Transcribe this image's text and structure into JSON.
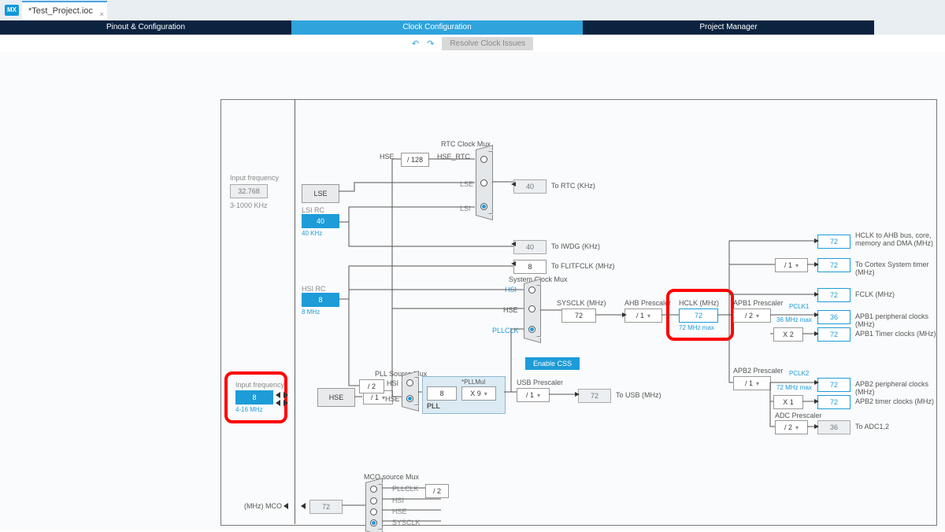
{
  "topbar": {
    "badge": "MX",
    "filename": "*Test_Project.ioc",
    "close": "×"
  },
  "tabs": {
    "t0": "Pinout & Configuration",
    "t1": "Clock Configuration",
    "t2": "Project Manager"
  },
  "toolbar": {
    "resolve": "Resolve Clock Issues"
  },
  "left": {
    "lse": {
      "label": "Input frequency",
      "value": "32.768",
      "range": "3-1000 KHz"
    },
    "hse": {
      "label": "Input frequency",
      "value": "8",
      "range": "4-16 MHz"
    },
    "lse_name": "LSE",
    "lse_rc": "LSI RC",
    "lse_rc_val": "40",
    "lse_rc_unit": "40 KHz",
    "hsi_rc": "HSI RC",
    "hsi_rc_val": "8",
    "hsi_rc_unit": "8 MHz",
    "hse_name": "HSE",
    "hse_div": "/ 1"
  },
  "rtc": {
    "title": "RTC Clock Mux",
    "hse": "HSE",
    "div": "/ 128",
    "hse_rtc": "HSE_RTC",
    "lse": "LSE",
    "lsi": "LSI",
    "out": "40",
    "out_lbl": "To RTC (KHz)"
  },
  "iwdg": {
    "value": "40",
    "label": "To IWDG (KHz)"
  },
  "flitf": {
    "value": "8",
    "label": "To FLITFCLK (MHz)"
  },
  "sysclk": {
    "title": "System Clock Mux",
    "hsi": "HSI",
    "hse": "HSE",
    "pllclk": "PLLCLK",
    "label": "SYSCLK (MHz)",
    "value": "72"
  },
  "css": "Enable CSS",
  "pll": {
    "src_title": "PLL Source Mux",
    "div2": "/ 2",
    "hsi": "HSI",
    "hse": "HSE",
    "title": "PLL",
    "pllmul_hdr": "*PLLMul",
    "input": "8",
    "mult": "X 9"
  },
  "usb": {
    "title": "USB Prescaler",
    "div": "/ 1",
    "value": "72",
    "label": "To USB (MHz)"
  },
  "ahb": {
    "label": "AHB Prescaler",
    "div": "/ 1"
  },
  "hclk": {
    "label": "HCLK (MHz)",
    "value": "72",
    "max": "72 MHz max"
  },
  "apb1": {
    "label": "APB1 Prescaler",
    "div": "/ 2",
    "max": "36 MHz max",
    "x": "X 2"
  },
  "apb2": {
    "label": "APB2 Prescaler",
    "div": "/ 1",
    "max": "72 MHz max",
    "x": "X 1"
  },
  "adc": {
    "label": "ADC Prescaler",
    "div": "/ 2",
    "value": "36",
    "out": "To ADC1,2"
  },
  "outs": {
    "ahb": {
      "v": "72",
      "l": "HCLK to AHB bus, core, memory and DMA (MHz)"
    },
    "cortex": {
      "div": "/ 1",
      "v": "72",
      "l": "To Cortex System timer (MHz)"
    },
    "fclk": {
      "v": "72",
      "l": "FCLK (MHz)"
    },
    "pclk1": {
      "hdr": "PCLK1",
      "v": "36",
      "l": "APB1 peripheral clocks (MHz)"
    },
    "tim1": {
      "v": "72",
      "l": "APB1 Timer clocks (MHz)"
    },
    "pclk2": {
      "hdr": "PCLK2",
      "v": "72",
      "l": "APB2 peripheral clocks (MHz)"
    },
    "tim2": {
      "v": "72",
      "l": "APB2 timer clocks (MHz)"
    }
  },
  "mco": {
    "title": "MCO source Mux",
    "pllclk": "PLLCLK",
    "div": "/ 2",
    "hsi": "HSI",
    "hse": "HSE",
    "sysclk": "SYSCLK",
    "value": "72",
    "label": "(MHz) MCO"
  }
}
